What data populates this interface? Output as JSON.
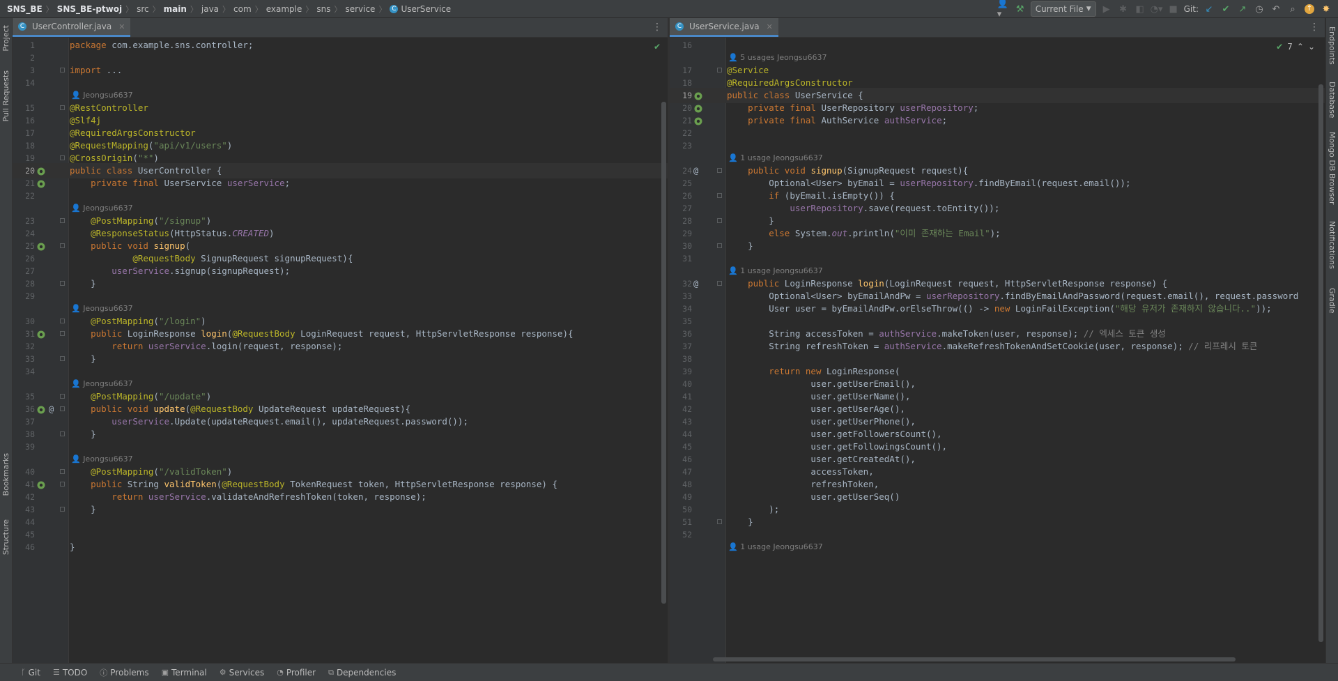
{
  "breadcrumb": [
    "SNS_BE",
    "SNS_BE-ptwoj",
    "src",
    "main",
    "java",
    "com",
    "example",
    "sns",
    "service",
    "UserService"
  ],
  "toolbar": {
    "run_config": "Current File",
    "git_label": "Git:"
  },
  "left_stripe": [
    "Project",
    "Pull Requests",
    "Bookmarks",
    "Structure"
  ],
  "right_stripe": [
    "Endpoints",
    "Database",
    "Mongo DB Browser",
    "Notifications",
    "Gradle"
  ],
  "bottom_tools": [
    "Git",
    "TODO",
    "Problems",
    "Terminal",
    "Services",
    "Profiler",
    "Dependencies"
  ],
  "left_editor": {
    "tab": "UserController.java",
    "lines": [
      {
        "n": "1",
        "t": "package com.example.sns.controller;"
      },
      {
        "n": "2",
        "t": ""
      },
      {
        "n": "3",
        "t": "import ..."
      },
      {
        "n": "14",
        "t": ""
      },
      {
        "hint": "Jeongsu6637"
      },
      {
        "n": "15",
        "t": "@RestController"
      },
      {
        "n": "16",
        "t": "@Slf4j"
      },
      {
        "n": "17",
        "t": "@RequiredArgsConstructor"
      },
      {
        "n": "18",
        "t": "@RequestMapping(\"api/v1/users\")"
      },
      {
        "n": "19",
        "t": "@CrossOrigin(\"*\")"
      },
      {
        "n": "20",
        "t": "public class UserController {"
      },
      {
        "n": "21",
        "t": "    private final UserService userService;"
      },
      {
        "n": "22",
        "t": ""
      },
      {
        "hint": "Jeongsu6637"
      },
      {
        "n": "23",
        "t": "    @PostMapping(\"/signup\")"
      },
      {
        "n": "24",
        "t": "    @ResponseStatus(HttpStatus.CREATED)"
      },
      {
        "n": "25",
        "t": "    public void signup("
      },
      {
        "n": "26",
        "t": "            @RequestBody SignupRequest signupRequest){"
      },
      {
        "n": "27",
        "t": "        userService.signup(signupRequest);"
      },
      {
        "n": "28",
        "t": "    }"
      },
      {
        "n": "29",
        "t": ""
      },
      {
        "hint": "Jeongsu6637"
      },
      {
        "n": "30",
        "t": "    @PostMapping(\"/login\")"
      },
      {
        "n": "31",
        "t": "    public LoginResponse login(@RequestBody LoginRequest request, HttpServletResponse response){"
      },
      {
        "n": "32",
        "t": "        return userService.login(request, response);"
      },
      {
        "n": "33",
        "t": "    }"
      },
      {
        "n": "34",
        "t": ""
      },
      {
        "hint": "Jeongsu6637"
      },
      {
        "n": "35",
        "t": "    @PostMapping(\"/update\")"
      },
      {
        "n": "36",
        "t": "    public void update(@RequestBody UpdateRequest updateRequest){"
      },
      {
        "n": "37",
        "t": "        userService.Update(updateRequest.email(), updateRequest.password());"
      },
      {
        "n": "38",
        "t": "    }"
      },
      {
        "n": "39",
        "t": ""
      },
      {
        "hint": "Jeongsu6637"
      },
      {
        "n": "40",
        "t": "    @PostMapping(\"/validToken\")"
      },
      {
        "n": "41",
        "t": "    public String validToken(@RequestBody TokenRequest token, HttpServletResponse response) {"
      },
      {
        "n": "42",
        "t": "        return userService.validateAndRefreshToken(token, response);"
      },
      {
        "n": "43",
        "t": "    }"
      },
      {
        "n": "44",
        "t": ""
      },
      {
        "n": "45",
        "t": ""
      },
      {
        "n": "46",
        "t": "}"
      }
    ]
  },
  "right_editor": {
    "tab": "UserService.java",
    "inspection_count": "7",
    "lines": [
      {
        "n": "16",
        "t": ""
      },
      {
        "hint": "5 usages   Jeongsu6637"
      },
      {
        "n": "17",
        "t": "@Service"
      },
      {
        "n": "18",
        "t": "@RequiredArgsConstructor"
      },
      {
        "n": "19",
        "t": "public class UserService {"
      },
      {
        "n": "20",
        "t": "    private final UserRepository userRepository;"
      },
      {
        "n": "21",
        "t": "    private final AuthService authService;"
      },
      {
        "n": "22",
        "t": ""
      },
      {
        "n": "23",
        "t": ""
      },
      {
        "hint": "1 usage   Jeongsu6637"
      },
      {
        "n": "24",
        "t": "    public void signup(SignupRequest request){"
      },
      {
        "n": "25",
        "t": "        Optional<User> byEmail = userRepository.findByEmail(request.email());"
      },
      {
        "n": "26",
        "t": "        if (byEmail.isEmpty()) {"
      },
      {
        "n": "27",
        "t": "            userRepository.save(request.toEntity());"
      },
      {
        "n": "28",
        "t": "        }"
      },
      {
        "n": "29",
        "t": "        else System.out.println(\"이미 존재하는 Email\");"
      },
      {
        "n": "30",
        "t": "    }"
      },
      {
        "n": "31",
        "t": ""
      },
      {
        "hint": "1 usage   Jeongsu6637"
      },
      {
        "n": "32",
        "t": "    public LoginResponse login(LoginRequest request, HttpServletResponse response) {"
      },
      {
        "n": "33",
        "t": "        Optional<User> byEmailAndPw = userRepository.findByEmailAndPassword(request.email(), request.password"
      },
      {
        "n": "34",
        "t": "        User user = byEmailAndPw.orElseThrow(() -> new LoginFailException(\"해당 유저가 존재하지 않습니다..\"));"
      },
      {
        "n": "35",
        "t": ""
      },
      {
        "n": "36",
        "t": "        String accessToken = authService.makeToken(user, response); // 엑세스 토큰 생성"
      },
      {
        "n": "37",
        "t": "        String refreshToken = authService.makeRefreshTokenAndSetCookie(user, response); // 리프레시 토큰"
      },
      {
        "n": "38",
        "t": ""
      },
      {
        "n": "39",
        "t": "        return new LoginResponse("
      },
      {
        "n": "40",
        "t": "                user.getUserEmail(),"
      },
      {
        "n": "41",
        "t": "                user.getUserName(),"
      },
      {
        "n": "42",
        "t": "                user.getUserAge(),"
      },
      {
        "n": "43",
        "t": "                user.getUserPhone(),"
      },
      {
        "n": "44",
        "t": "                user.getFollowersCount(),"
      },
      {
        "n": "45",
        "t": "                user.getFollowingsCount(),"
      },
      {
        "n": "46",
        "t": "                user.getCreatedAt(),"
      },
      {
        "n": "47",
        "t": "                accessToken,"
      },
      {
        "n": "48",
        "t": "                refreshToken,"
      },
      {
        "n": "49",
        "t": "                user.getUserSeq()"
      },
      {
        "n": "50",
        "t": "        );"
      },
      {
        "n": "51",
        "t": "    }"
      },
      {
        "n": "52",
        "t": ""
      },
      {
        "hint": "1 usage   Jeongsu6637"
      }
    ]
  }
}
